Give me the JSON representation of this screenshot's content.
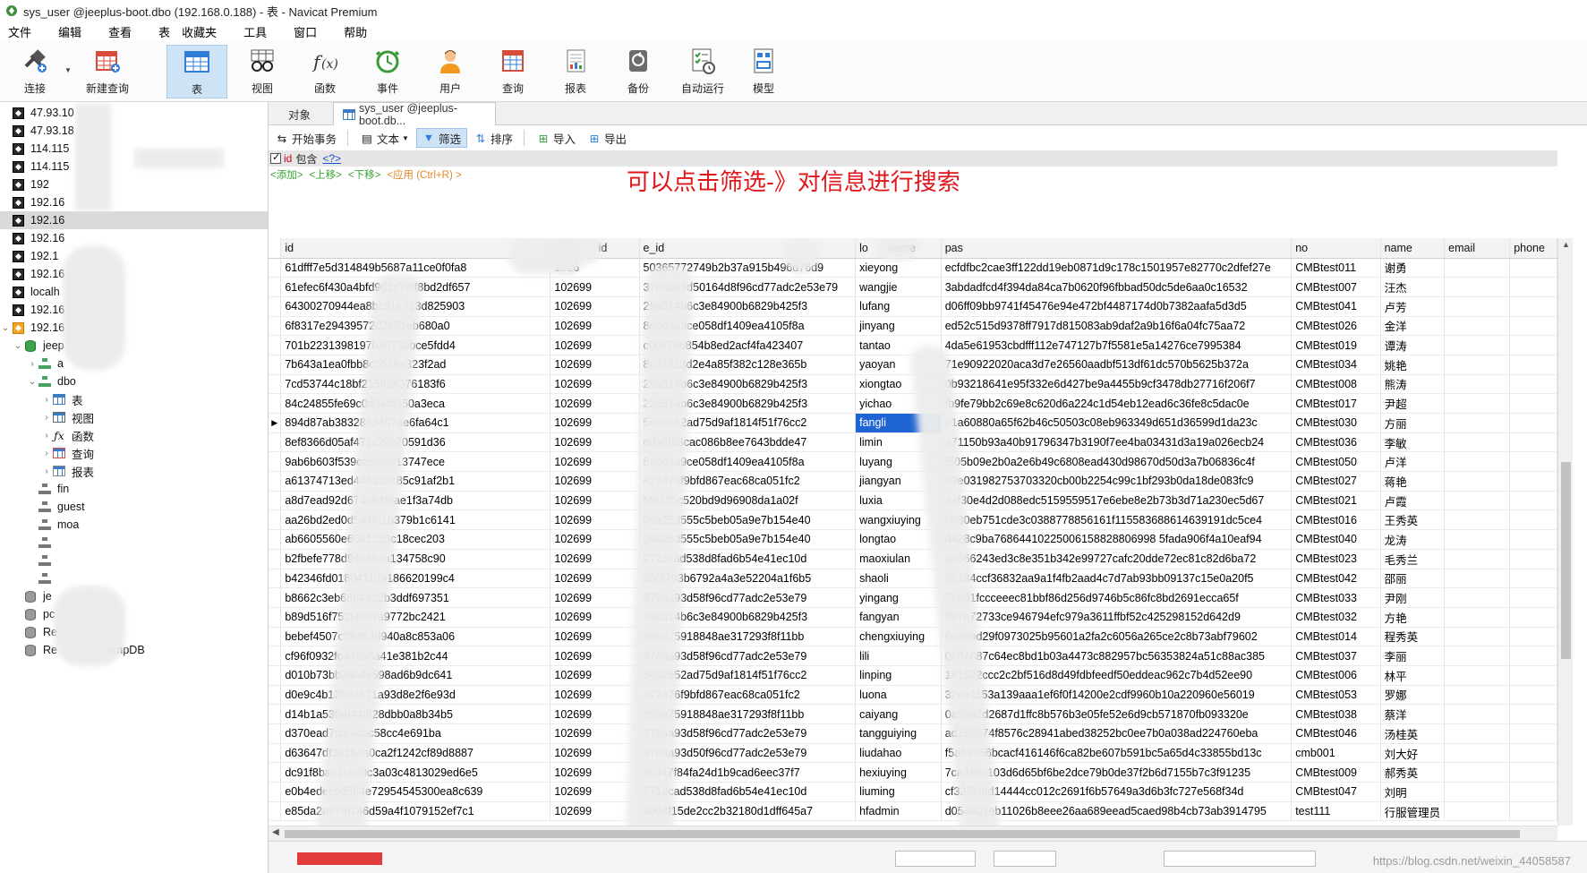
{
  "window": {
    "title": "sys_user @jeeplus-boot.dbo (192.168.0.188) - 表 - Navicat Premium"
  },
  "menu": [
    "文件",
    "编辑",
    "查看",
    "表",
    "收藏夹",
    "工具",
    "窗口",
    "帮助"
  ],
  "ribbon": {
    "connect": "连接",
    "new_query": "新建查询",
    "table": "表",
    "view": "视图",
    "function": "函数",
    "event": "事件",
    "user": "用户",
    "query": "查询",
    "report": "报表",
    "backup": "备份",
    "automation": "自动运行",
    "model": "模型"
  },
  "nav": {
    "items": [
      {
        "label": "47.93.10"
      },
      {
        "label": "47.93.18"
      },
      {
        "label": "114.115"
      },
      {
        "label": "114.115"
      },
      {
        "label": "192"
      },
      {
        "label": "192.16"
      },
      {
        "label": "192.16"
      },
      {
        "label": "192.16"
      },
      {
        "label": "192.1"
      },
      {
        "label": "192.16"
      },
      {
        "label": "localh"
      },
      {
        "label": "192.16"
      },
      {
        "label": "192.16"
      },
      {
        "label": "jeep"
      },
      {
        "label": "a"
      },
      {
        "label": "dbo"
      },
      {
        "label": "表"
      },
      {
        "label": "视图"
      },
      {
        "label": "函数"
      },
      {
        "label": "查询"
      },
      {
        "label": "报表"
      },
      {
        "label": "fin"
      },
      {
        "label": "guest"
      },
      {
        "label": "moa"
      },
      {
        "label": "je"
      },
      {
        "label": "pc"
      },
      {
        "label": "Re"
      },
      {
        "label": "Re",
        "suffix": "empDB"
      }
    ]
  },
  "tabs": {
    "objects": "对象",
    "active": "sys_user @jeeplus-boot.db..."
  },
  "subtoolbar": {
    "begin_tx": "开始事务",
    "text": "文本",
    "filter": "筛选",
    "sort": "排序",
    "import": "导入",
    "export": "导出"
  },
  "filter": {
    "field": "id",
    "operator": "包含",
    "value": "<?>",
    "actions": {
      "add": "<添加>",
      "up": "<上移>",
      "down": "<下移>",
      "apply": "<应用 (Ctrl+R) >"
    }
  },
  "annotation": "可以点击筛选-》对信息进行搜索",
  "grid": {
    "columns": [
      "id",
      "co",
      "id",
      "e_id",
      "lo",
      "name",
      "pas",
      "no",
      "name",
      "email",
      "phone"
    ],
    "highlight_row": 8,
    "rows": [
      [
        "61dfff7e5d314849b5687a11ce0f0fa8",
        "1026",
        "50365772749b2b37a915b496d76d9",
        "xieyong",
        "ecfdfbc2cae3ff122dd19eb0871d9c178c1501957e82770c2dfef27e",
        "CMBtest011",
        "谢勇"
      ],
      [
        "61efec6f430a4bfd9d2c78d8bd2df657",
        "102699",
        "378aa93d50164d8f96cd77adc2e53e79",
        "wangjie",
        "3abdadfcd4f394da84ca7b0620f96fbbad50dc5de6aa0c16532",
        "CMBtest007",
        "汪杰"
      ],
      [
        "64300270944ea8bc51e713d825903",
        "102699",
        "29a514b6c3e84900b6829b425f3",
        "lufang",
        "d06ff09bb9741f45476e94e472bf4487174d0b7382aafa5d3d5",
        "CMBtest041",
        "卢芳"
      ],
      [
        "6f8317e29439572d2651eb680a0",
        "102699",
        "8d6daa9ce058df1409ea4105f8a",
        "jinyang",
        "ed52c515d9378ff7917d815083ab9daf2a9b16f6a04fc75aa72",
        "CMBtest026",
        "金洋"
      ],
      [
        "701b2231398197b38730bce5fdd4",
        "102699",
        "c0bc766854b8ed2acf4fa423407",
        "tantao",
        "4da5e61953cbdfff112e747127b7f5581e5a14276ce7995384",
        "CMBtest019",
        "谭涛"
      ],
      [
        "7b643a1ea0fbb8c5536a323f2ad",
        "102699",
        "8c03323d2e4a85f382c128e365b",
        "yaoyan",
        "71e90922020aca3d7e26560aadbf513df61dc570b5625b372a",
        "CMBtest034",
        "姚艳"
      ],
      [
        "7cd53744c18bf215628376183f6",
        "102699",
        "29a514b6c3e84900b6829b425f3",
        "xiongtao",
        "0b93218641e95f332e6d427be9a4455b9cf3478db27716f206f7",
        "CMBtest008",
        "熊涛"
      ],
      [
        "84c24855fe69c0a34fb050a3eca",
        "102699",
        "29a514b6c3e84900b6829b425f3",
        "yichao",
        "fb9fe79bb2c69e8c620d6a224c1d54eb12ead6c36fe8c5dac0e",
        "CMBtest017",
        "尹超"
      ],
      [
        "894d87ab38328634ff7ae6fa64c1",
        "102699",
        "5ea2e52ad75d9af1814f51f76cc2",
        "fangli",
        "e1a60880a65f62b46c50503c08eb963349d651d36599d1da23c",
        "CMBtest030",
        "方丽"
      ],
      [
        "8ef8366d05af471c22c70591d36",
        "102699",
        "dda8f68cac086b8ee7643bdde47",
        "limin",
        "a71150b93a40b91796347b3190f7ee4ba03431d3a19a026ecb24",
        "CMBtest036",
        "李敏"
      ],
      [
        "9ab6b603f539cc8fa0813747ece",
        "102699",
        "8d6daa9ce058df1409ea4105f8a",
        "luyang",
        "f505b09e2b0a2e6b49c6808ead430d98670d50d3a7b06836c4f",
        "CMBtest050",
        "卢洋"
      ],
      [
        "a61374713ed446325c85c91af2b1",
        "102699",
        "427476f9bfd867eac68ca051fc2",
        "jiangyan",
        "d9e031982753703320cb00b2254c99c1bf293b0da18de083fc9",
        "CMBtest027",
        "蒋艳"
      ],
      [
        "a8d7ead92d674083f0ae1f3a74db",
        "102699",
        "5f6335c520bd9d96908da1a02f",
        "luxia",
        "aaf30e4d2d088edc5159559517e6ebe8e2b73b3d71a230ec5d67",
        "CMBtest021",
        "卢霞"
      ],
      [
        "aa26bd2ed0d544fe1b379b1c6141",
        "102699",
        "09a25d555c5beb05a9e7b154e40",
        "wangxiuying",
        "b930eb751cde3c0388778856161f115583688614639191dc5ce4",
        "CMBtest016",
        "王秀英"
      ],
      [
        "ab6605560e6641229c18cec203",
        "102699",
        "09a25d555c5beb05a9e7b154e40",
        "longtao",
        "d428c9ba76864410225006158828806998 5fada906f4a10eaf94",
        "CMBtest040",
        "龙涛"
      ],
      [
        "b2fbefe778d94b4bca134758c90",
        "102699",
        "2713cad538d8fad6b54e41ec10d",
        "maoxiulan",
        "aa366243ed3c8e351b342e99727cafc20dde72ec81c82d6ba72",
        "CMBtest023",
        "毛秀兰"
      ],
      [
        "b42346fd0180411d9186620199c4",
        "102699",
        "35f8793b6792a4a3e52204a1f6b5",
        "shaoli",
        "65184ccf36832aa9a1f4fb2aad4c7d7ab93bb09137c15e0a20f5",
        "CMBtest042",
        "邵丽"
      ],
      [
        "b8662c3eb6864422b3ddf697351",
        "102699",
        "378aa93d58f96cd77adc2e53e79",
        "yingang",
        "7f4f61fccceeec81bbf86d256d9746b5c86fc8bd2691ecca65f",
        "CMBtest033",
        "尹刚"
      ],
      [
        "b89d516f752f4cd7a9772bc2421",
        "102699",
        "29a514b6c3e84900b6829b425f3",
        "fangyan",
        "ff67b72733ce946794efc979a3611ffbf52c425298152d642d9",
        "CMBtest032",
        "方艳"
      ],
      [
        "bebef4507c59483d940a8c853a06",
        "102699",
        "e96e75918848ae317293f8f11bb",
        "chengxiuying",
        "6da5bd29f0973025b95601a2fa2c6056a265ce2c8b73abf79602",
        "CMBtest014",
        "程秀英"
      ],
      [
        "cf96f0932fc44e66a41e381b2c44",
        "102699",
        "378aa93d58f96cd77adc2e53e79",
        "lili",
        "0684687c64ec8bd1b03a4473c882957bc56353824a51c88ac385",
        "CMBtest037",
        "李丽"
      ],
      [
        "d010b73bb34b4e598ad6b9dc641",
        "102699",
        "5ea2e52ad75d9af1814f51f76cc2",
        "linping",
        "141522ccc2c2bf516d8d49fdbfeedf50eddeac962c7b4d52ee90",
        "CMBtest006",
        "林平"
      ],
      [
        "d0e9c4b12b9a471a93d8e2f6e93d",
        "102699",
        "427476f9bfd867eac68ca051fc2",
        "luona",
        "32ae1153a139aaa1ef6f0f14200e2cdf9960b10a220960e56019",
        "CMBtest053",
        "罗娜"
      ],
      [
        "d14b1a53fad44f828dbb0a8b34b5",
        "102699",
        "e96e75918848ae317293f8f11bb",
        "caiyang",
        "0a93a2d2687d1ffc8b576b3e05fe52e6d9cb571870fb093320e",
        "CMBtest038",
        "蔡洋"
      ],
      [
        "d370ead7fcb44ac58cc4e691ba",
        "102699",
        "378aa93d58f96cd77adc2e53e79",
        "tangguiying",
        "ad15b874f8576c28941abed38252bc0ee7b0a038ad224760eba",
        "CMBtest046",
        "汤桂英"
      ],
      [
        "d63647df38164a0ca2f1242cf89d8887",
        "102699",
        "378aa93d50f96cd77adc2e53e79",
        "liudahao",
        "f5a63056bcacf416146f6ca82be607b591bc5a65d4c33855bd13c",
        "cmb001",
        "刘大好"
      ],
      [
        "dc91f8bac1c040c3a03c4813029ed6e5",
        "102699",
        "6c447f84fa24d1b9cad6eec37f7",
        "hexiuying",
        "7ca48ec103d6d65bf6be2dce79b0de37f2b6d7155b7c3f91235",
        "CMBtest009",
        "郝秀英"
      ],
      [
        "e0b4edec9d584e72954545300ea8c639",
        "102699",
        "2713cad538d8fad6b54e41ec10d",
        "liuming",
        "cf32f899d14444cc012c2691f6b57649a3d6b3fc727e568f34d",
        "CMBtest047",
        "刘明"
      ],
      [
        "e85da2a97fd146d59a4f1079152ef7c1",
        "102699",
        "40e4f15de2cc2b32180d1dff645a7",
        "hfadmin",
        "d054b01eb11026b8eee26aa689eead5caed98b4cb73ab3914795",
        "test111",
        "行服管理员"
      ]
    ]
  },
  "watermark": "https://blog.csdn.net/weixin_44058587"
}
